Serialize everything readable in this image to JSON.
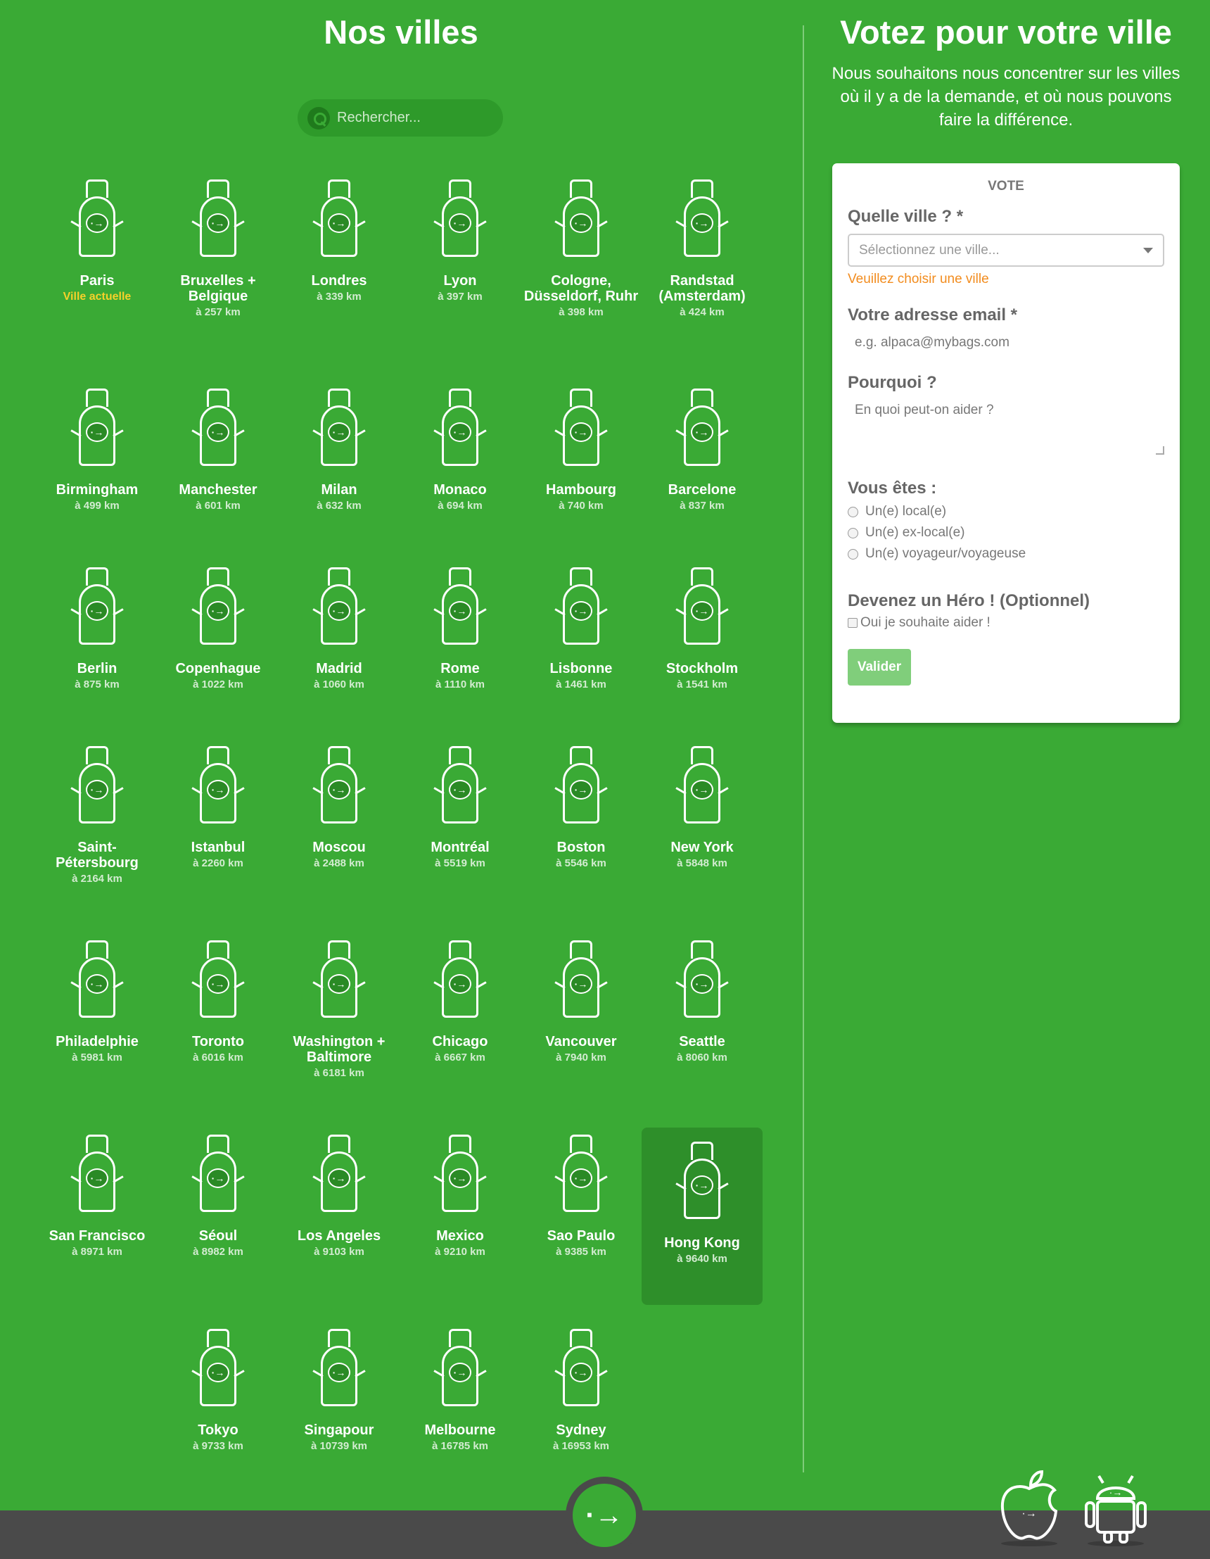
{
  "left": {
    "title": "Nos villes",
    "search_placeholder": "Rechercher..."
  },
  "cities": [
    {
      "name": "Paris",
      "dist": "",
      "current": "Ville actuelle"
    },
    {
      "name": "Bruxelles + Belgique",
      "dist": "à 257 km"
    },
    {
      "name": "Londres",
      "dist": "à 339 km"
    },
    {
      "name": "Lyon",
      "dist": "à 397 km"
    },
    {
      "name": "Cologne, Düsseldorf, Ruhr",
      "dist": "à 398 km"
    },
    {
      "name": "Randstad (Amsterdam)",
      "dist": "à 424 km"
    },
    {
      "name": "Birmingham",
      "dist": "à 499 km"
    },
    {
      "name": "Manchester",
      "dist": "à 601 km"
    },
    {
      "name": "Milan",
      "dist": "à 632 km"
    },
    {
      "name": "Monaco",
      "dist": "à 694 km"
    },
    {
      "name": "Hambourg",
      "dist": "à 740 km"
    },
    {
      "name": "Barcelone",
      "dist": "à 837 km"
    },
    {
      "name": "Berlin",
      "dist": "à 875 km"
    },
    {
      "name": "Copenhague",
      "dist": "à 1022 km"
    },
    {
      "name": "Madrid",
      "dist": "à 1060 km"
    },
    {
      "name": "Rome",
      "dist": "à 1110 km"
    },
    {
      "name": "Lisbonne",
      "dist": "à 1461 km"
    },
    {
      "name": "Stockholm",
      "dist": "à 1541 km"
    },
    {
      "name": "Saint-Pétersbourg",
      "dist": "à 2164 km"
    },
    {
      "name": "Istanbul",
      "dist": "à 2260 km"
    },
    {
      "name": "Moscou",
      "dist": "à 2488 km"
    },
    {
      "name": "Montréal",
      "dist": "à 5519 km"
    },
    {
      "name": "Boston",
      "dist": "à 5546 km"
    },
    {
      "name": "New York",
      "dist": "à 5848 km"
    },
    {
      "name": "Philadelphie",
      "dist": "à 5981 km"
    },
    {
      "name": "Toronto",
      "dist": "à 6016 km"
    },
    {
      "name": "Washington + Baltimore",
      "dist": "à 6181 km"
    },
    {
      "name": "Chicago",
      "dist": "à 6667 km"
    },
    {
      "name": "Vancouver",
      "dist": "à 7940 km"
    },
    {
      "name": "Seattle",
      "dist": "à 8060 km"
    },
    {
      "name": "San Francisco",
      "dist": "à 8971 km"
    },
    {
      "name": "Séoul",
      "dist": "à 8982 km"
    },
    {
      "name": "Los Angeles",
      "dist": "à 9103 km"
    },
    {
      "name": "Mexico",
      "dist": "à 9210 km"
    },
    {
      "name": "Sao Paulo",
      "dist": "à 9385 km"
    },
    {
      "name": "Hong Kong",
      "dist": "à 9640 km",
      "selected": true
    },
    {
      "name": "Tokyo",
      "dist": "à 9733 km"
    },
    {
      "name": "Singapour",
      "dist": "à 10739 km"
    },
    {
      "name": "Melbourne",
      "dist": "à 16785 km"
    },
    {
      "name": "Sydney",
      "dist": "à 16953 km"
    }
  ],
  "right": {
    "title": "Votez pour votre ville",
    "subtitle": "Nous souhaitons nous concentrer sur les villes où il y a de la demande, et où nous pouvons faire la différence.",
    "form": {
      "heading": "VOTE",
      "city_label": "Quelle ville ? *",
      "city_placeholder": "Sélectionnez une ville...",
      "city_error": "Veuillez choisir une ville",
      "email_label": "Votre adresse email *",
      "email_placeholder": "e.g. alpaca@mybags.com",
      "why_label": "Pourquoi ?",
      "why_placeholder": "En quoi peut-on aider ?",
      "you_are_label": "Vous êtes :",
      "options": [
        "Un(e) local(e)",
        "Un(e) ex-local(e)",
        "Un(e) voyageur/voyageuse"
      ],
      "hero_label": "Devenez un Héro ! (Optionnel)",
      "hero_checkbox": "Oui je souhaite aider !",
      "submit": "Valider"
    }
  },
  "colors": {
    "background": "#3aaa35",
    "footer": "#4a4a4a",
    "error": "#f28c1e",
    "current": "#f6d12a"
  }
}
